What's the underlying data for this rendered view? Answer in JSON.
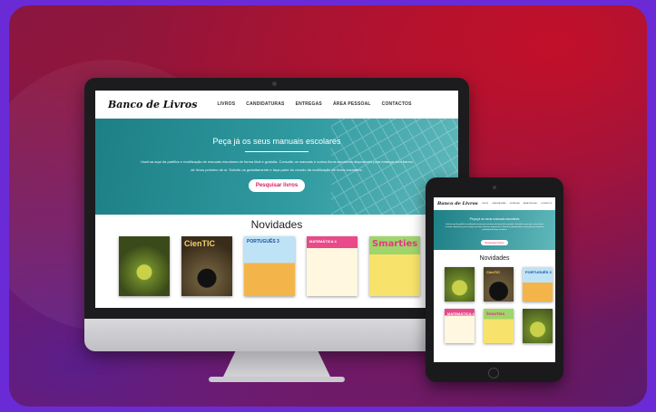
{
  "site": {
    "logo": "Banco de Livros",
    "nav": [
      "LIVROS",
      "CANDIDATURAS",
      "ENTREGAS",
      "ÁREA PESSOAL",
      "CONTACTOS"
    ],
    "hero": {
      "title": "Peça já os seus manuais escolares",
      "text": "Usufrua aqui da partilha e reutilização de manuais escolares de forma fácil e gratuita. Consulte os manuais e outros livros escolares disponíveis para entrega num banco de livros próximo de si. Solicite-os gratuitamente e faça parte do mundo da reutilização de livros escolares.",
      "button": "Pesquisar livros"
    },
    "section_title": "Novidades",
    "books": [
      {
        "title": ""
      },
      {
        "title": "CienTIC"
      },
      {
        "title": "PORTUGUÊS 3"
      },
      {
        "title": "MATEMÁTICA 4"
      },
      {
        "title": "Smarties"
      }
    ],
    "tablet_books": [
      {
        "title": ""
      },
      {
        "title": "CienTIC"
      },
      {
        "title": "PORTUGUÊS 3"
      },
      {
        "title": "MATEMÁTICA 4"
      },
      {
        "title": "Smarties"
      },
      {
        "title": ""
      }
    ]
  },
  "colors": {
    "accent": "#d81b60",
    "hero": "#2f9aa0",
    "background": "#9b1534"
  }
}
